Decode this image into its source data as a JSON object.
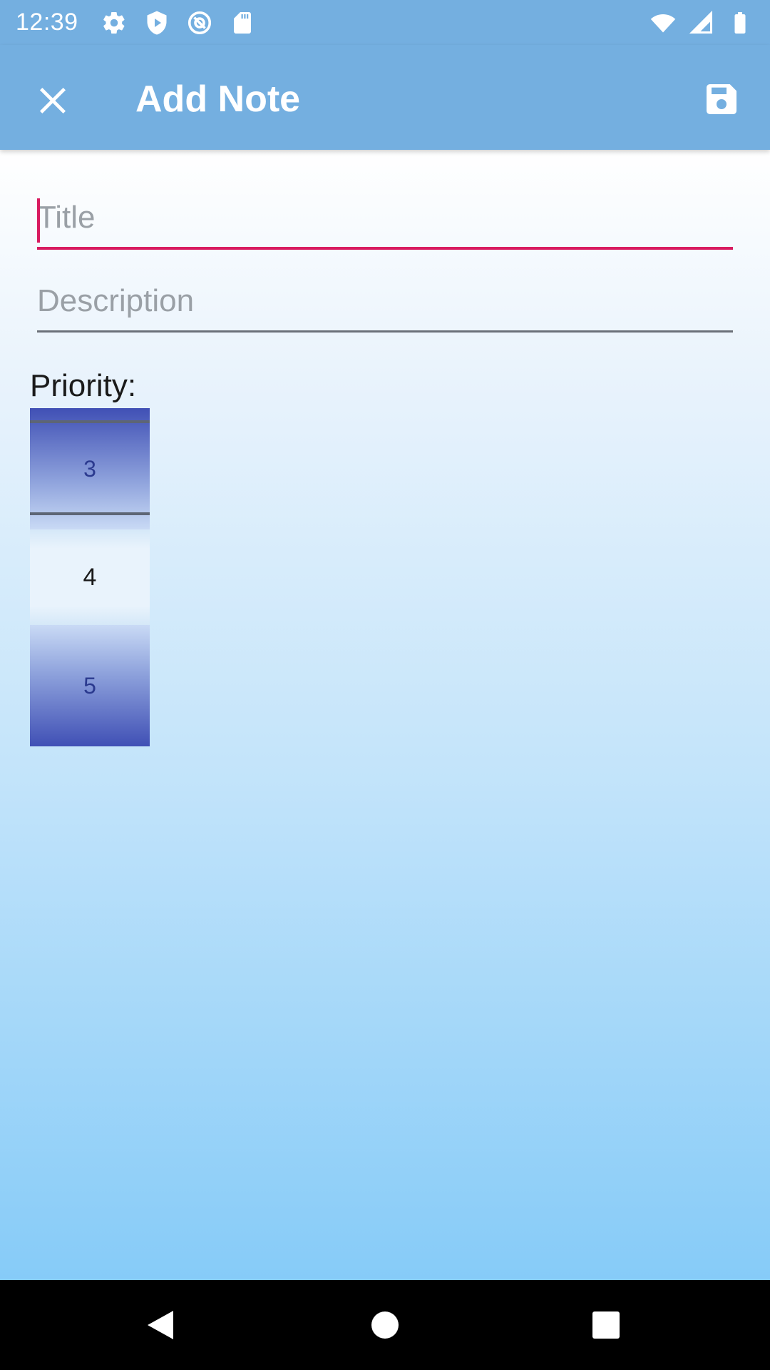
{
  "status_bar": {
    "time": "12:39",
    "icons": [
      "settings-icon",
      "shield-play-icon",
      "at-icon",
      "sd-card-icon",
      "wifi-icon",
      "signal-icon",
      "battery-icon"
    ]
  },
  "app_bar": {
    "title": "Add Note",
    "close_icon": "close-icon",
    "save_icon": "save-icon",
    "color": "#74afe0"
  },
  "form": {
    "title_placeholder": "Title",
    "title_value": "",
    "description_placeholder": "Description",
    "description_value": "",
    "accent_color": "#d81b60"
  },
  "priority": {
    "label": "Priority:",
    "previous": "3",
    "current": "4",
    "next": "5"
  },
  "nav_bar": {
    "buttons": [
      "back-icon",
      "home-icon",
      "recents-icon"
    ]
  }
}
